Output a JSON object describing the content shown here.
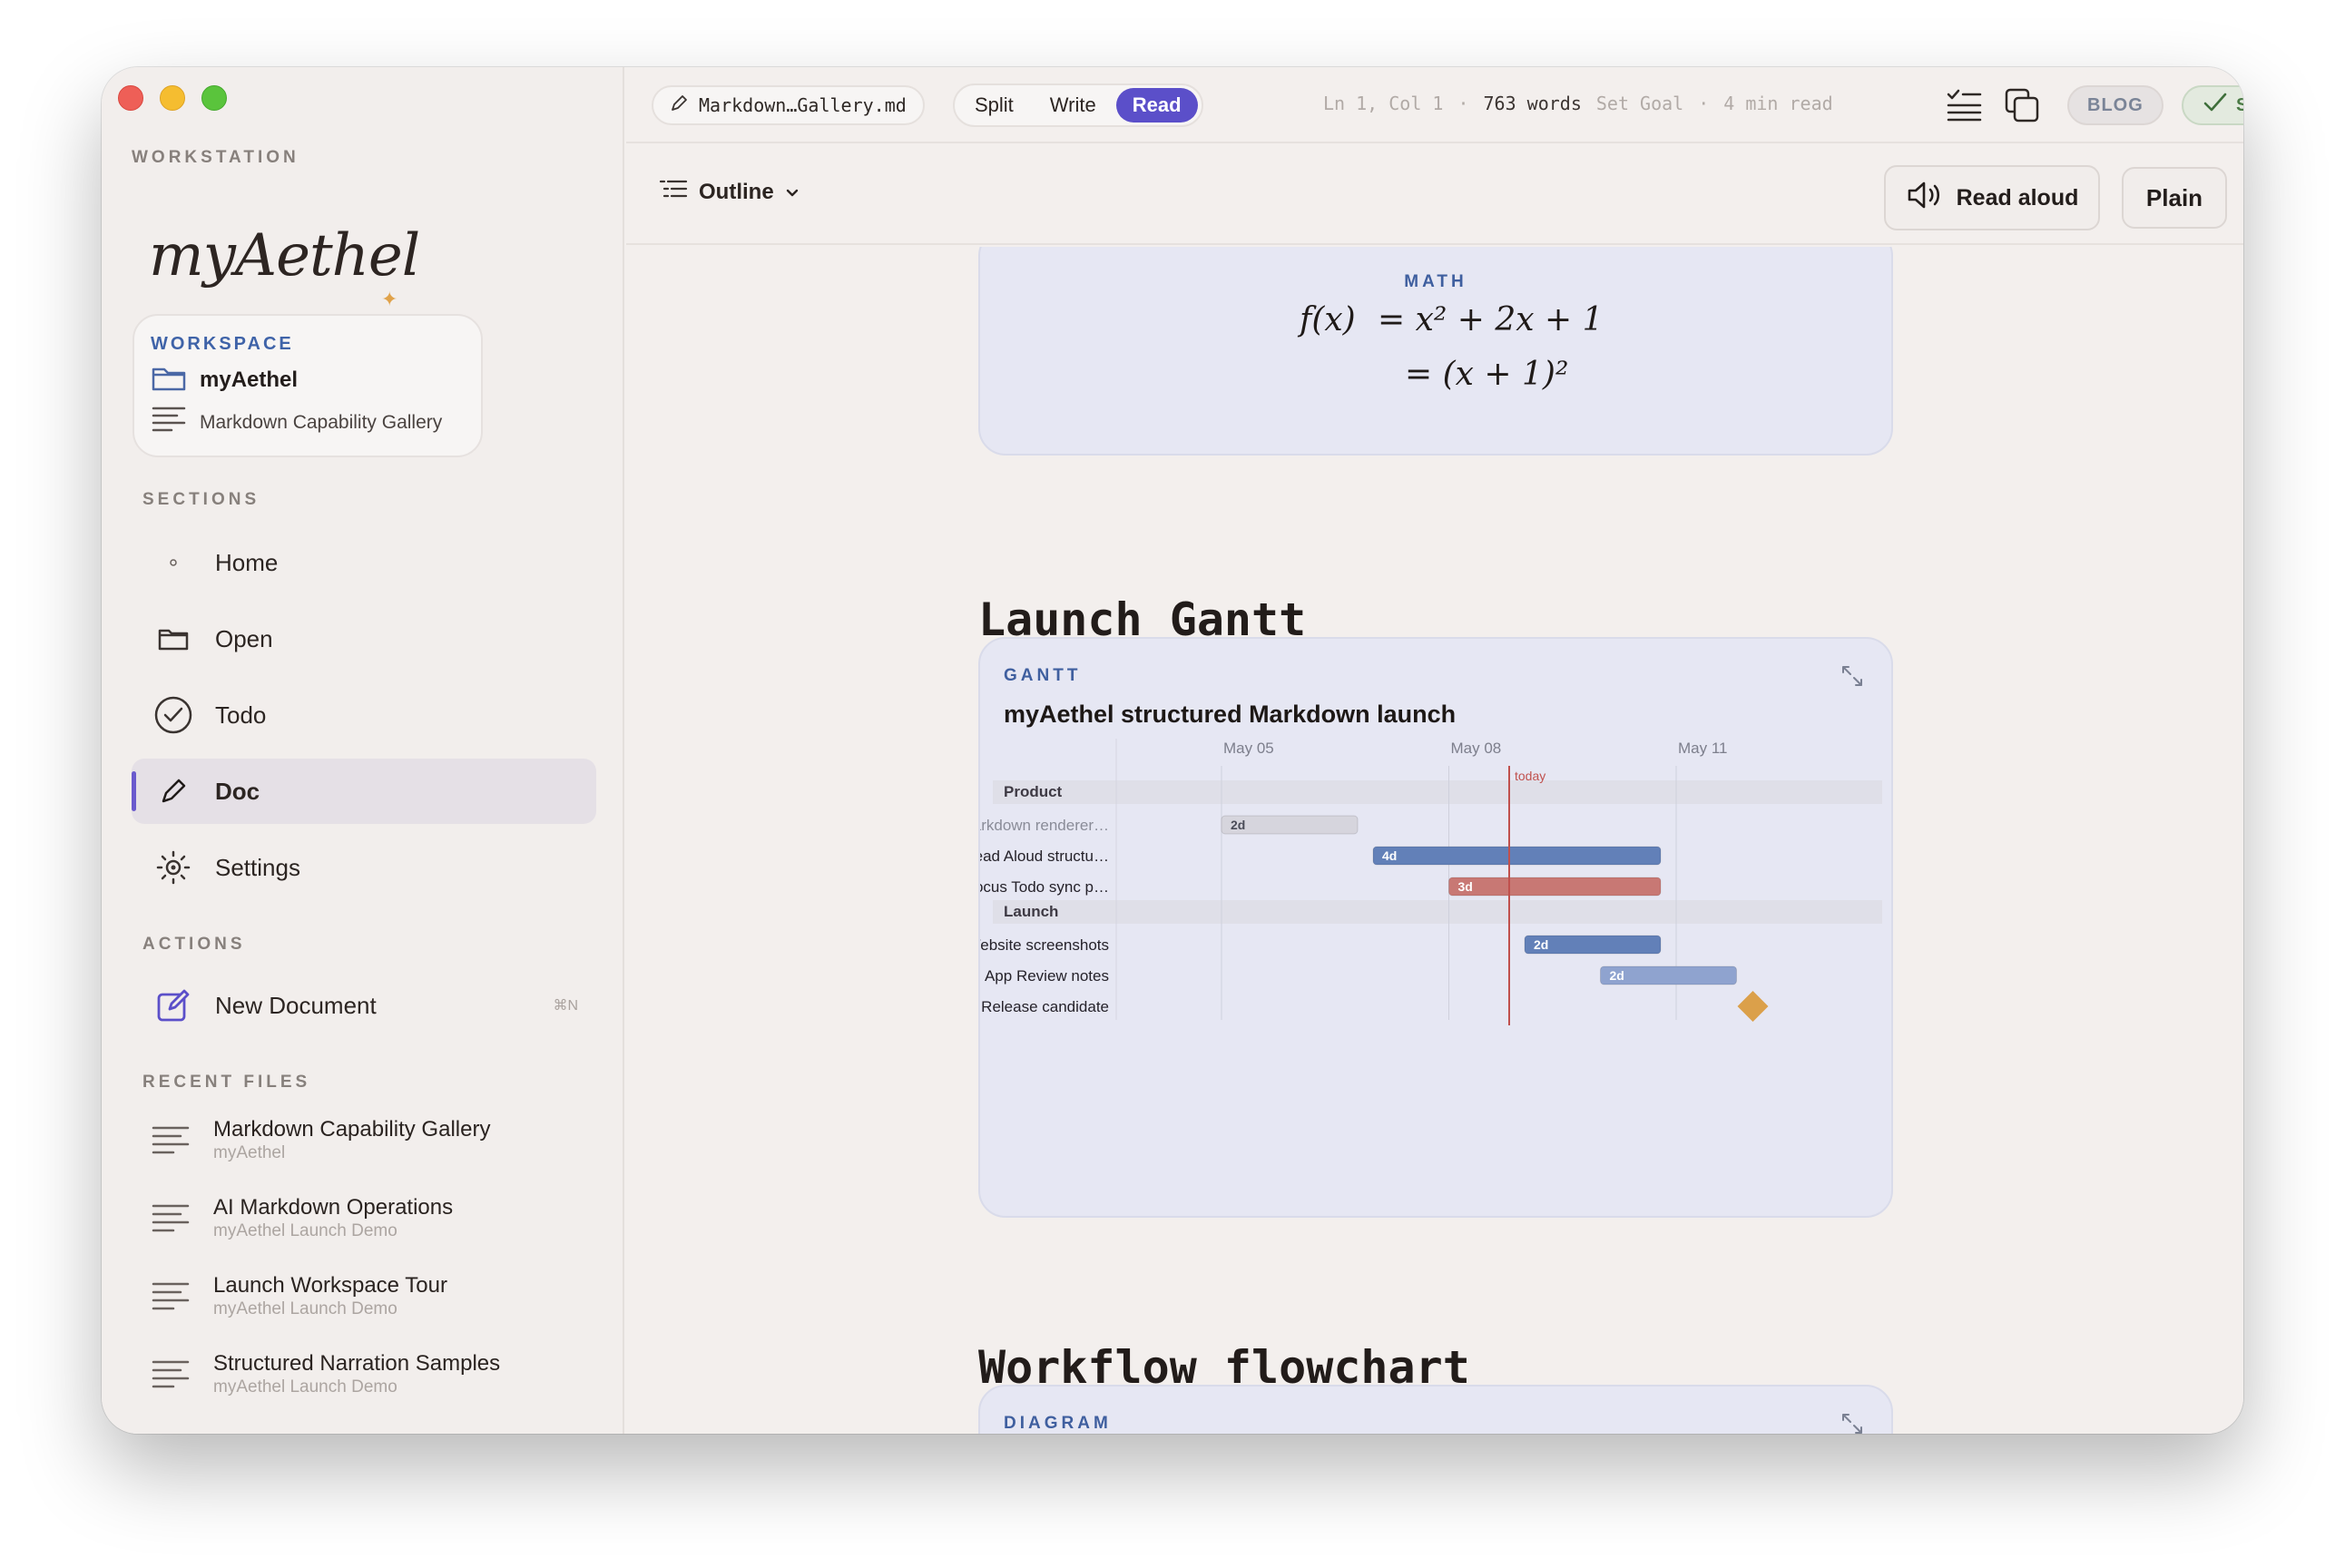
{
  "window": {
    "sidebar": {
      "workstation_label": "WORKSTATION",
      "logo_text": "myAethel",
      "workspace": {
        "header": "WORKSPACE",
        "name": "myAethel",
        "document": "Markdown Capability Gallery"
      },
      "sections_label": "SECTIONS",
      "sections": [
        {
          "label": "Home",
          "icon": "dot-icon"
        },
        {
          "label": "Open",
          "icon": "folder-icon"
        },
        {
          "label": "Todo",
          "icon": "check-circle-icon"
        },
        {
          "label": "Doc",
          "icon": "pencil-icon",
          "active": true
        },
        {
          "label": "Settings",
          "icon": "gear-icon"
        }
      ],
      "actions_label": "ACTIONS",
      "new_document": {
        "label": "New Document",
        "shortcut": "⌘N"
      },
      "recent_label": "RECENT FILES",
      "recent_files": [
        {
          "title": "Markdown Capability Gallery",
          "subtitle": "myAethel"
        },
        {
          "title": "AI Markdown Operations",
          "subtitle": "myAethel Launch Demo"
        },
        {
          "title": "Launch Workspace Tour",
          "subtitle": "myAethel Launch Demo"
        },
        {
          "title": "Structured Narration Samples",
          "subtitle": "myAethel Launch Demo"
        }
      ]
    },
    "toolbar": {
      "filename": "Markdown…Gallery.md",
      "modes": [
        "Split",
        "Write",
        "Read"
      ],
      "active_mode": "Read",
      "cursor": "Ln 1, Col 1",
      "separator": "·",
      "words": "763 words",
      "set_goal": "Set Goal",
      "read_time": "4 min read",
      "blog_label": "BLOG",
      "saved_label": "SAVED"
    },
    "subbar": {
      "outline_label": "Outline",
      "read_aloud_label": "Read aloud",
      "plain_label": "Plain"
    },
    "document": {
      "math": {
        "label": "MATH",
        "lhs": "f(x)",
        "line1": "= x² + 2x + 1",
        "line2": "= (x + 1)²"
      },
      "heading_gantt": "Launch Gantt",
      "gantt": {
        "label": "GANTT",
        "title": "myAethel structured Markdown launch"
      },
      "heading_flowchart": "Workflow flowchart",
      "diagram": {
        "label": "DIAGRAM"
      }
    },
    "colors": {
      "accent": "#5b4fc9",
      "bar_blue": "#6280b8",
      "bar_blue_light": "#8fa3cf",
      "bar_red": "#c87874",
      "bar_grey": "#d6d5dd",
      "milestone": "#dba04a",
      "today_line": "#c0504d"
    }
  },
  "chart_data": {
    "type": "gantt",
    "title": "myAethel structured Markdown launch",
    "x_ticks": [
      "May 05",
      "May 08",
      "May 11"
    ],
    "today": "May 09",
    "today_label": "today",
    "x_range": [
      "May 05",
      "May 13"
    ],
    "sections": [
      {
        "name": "Product",
        "tasks": [
          {
            "label": "Markdown renderer…",
            "start": "May 05",
            "duration_days": 2,
            "duration_label": "2d",
            "status": "done"
          },
          {
            "label": "Read Aloud structu…",
            "start": "May 07",
            "duration_days": 4,
            "duration_label": "4d",
            "status": "active"
          },
          {
            "label": "Focus Todo sync p…",
            "start": "May 08",
            "duration_days": 3,
            "duration_label": "3d",
            "status": "critical"
          }
        ]
      },
      {
        "name": "Launch",
        "tasks": [
          {
            "label": "Website screenshots",
            "start": "May 09",
            "duration_days": 2,
            "duration_label": "2d",
            "status": "active"
          },
          {
            "label": "App Review notes",
            "start": "May 10",
            "duration_days": 2,
            "duration_label": "2d",
            "status": "planned"
          },
          {
            "label": "Release candidate",
            "start": "May 12",
            "duration_days": 0,
            "duration_label": "",
            "status": "milestone"
          }
        ]
      }
    ]
  }
}
